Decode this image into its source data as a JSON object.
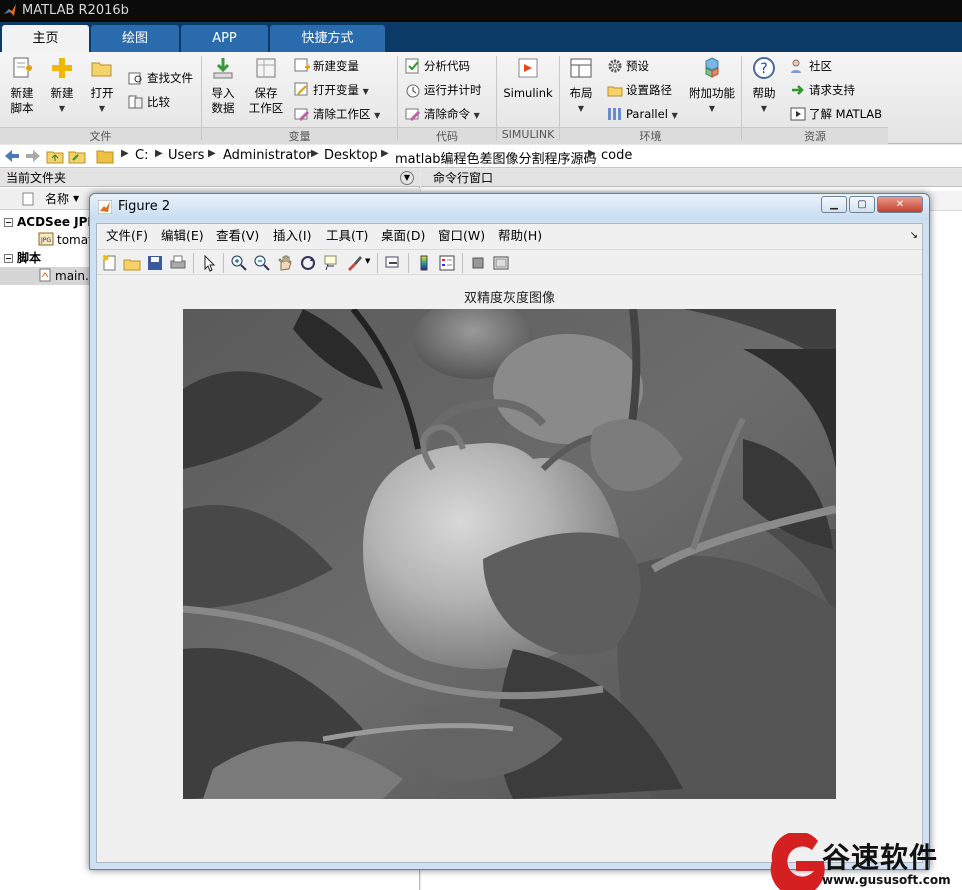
{
  "window": {
    "title": "MATLAB R2016b"
  },
  "tabs": [
    {
      "label": "主页"
    },
    {
      "label": "绘图"
    },
    {
      "label": "APP"
    },
    {
      "label": "快捷方式"
    }
  ],
  "ribbon": {
    "new_script": "新建\n脚本",
    "new_script_l1": "新建",
    "new_script_l2": "脚本",
    "new": "新建",
    "open": "打开",
    "find_files": "查找文件",
    "compare": "比较",
    "import_l1": "导入",
    "import_l2": "数据",
    "save_ws_l1": "保存",
    "save_ws_l2": "工作区",
    "new_variable": "新建变量",
    "open_variable": "打开变量",
    "clear_workspace": "清除工作区",
    "analyze_code": "分析代码",
    "run_and_time": "运行并计时",
    "clear_commands": "清除命令",
    "simulink": "Simulink",
    "layout": "布局",
    "preferences": "预设",
    "set_path": "设置路径",
    "parallel": "Parallel",
    "addons": "附加功能",
    "help": "帮助",
    "community": "社区",
    "request_support": "请求支持",
    "learn_matlab": "了解 MATLAB",
    "groups": {
      "file": "文件",
      "variable": "变量",
      "code": "代码",
      "simulink": "SIMULINK",
      "environment": "环境",
      "resources": "资源"
    }
  },
  "address": {
    "crumbs": [
      "C:",
      "Users",
      "Administrator",
      "Desktop",
      "matlab编程色差图像分割程序源码",
      "code"
    ]
  },
  "current_folder": {
    "title": "当前文件夹",
    "column_name": "名称",
    "rows": [
      {
        "label": "ACDSee JPE"
      },
      {
        "label": "tomat"
      },
      {
        "label": "脚本"
      },
      {
        "label": "main."
      }
    ]
  },
  "command_window": {
    "title": "命令行窗口"
  },
  "figure": {
    "title": "Figure 2",
    "menu": [
      "文件(F)",
      "编辑(E)",
      "查看(V)",
      "插入(I)",
      "工具(T)",
      "桌面(D)",
      "窗口(W)",
      "帮助(H)"
    ],
    "plot_title": "双精度灰度图像"
  },
  "watermark": {
    "text": "谷速软件",
    "url": "www.gususoft.com"
  },
  "colors": {
    "tab_bar": "#0c3a66",
    "tab": "#2a6bad",
    "title_bar": "#0b0b0b",
    "watermark_red": "#d42020"
  }
}
